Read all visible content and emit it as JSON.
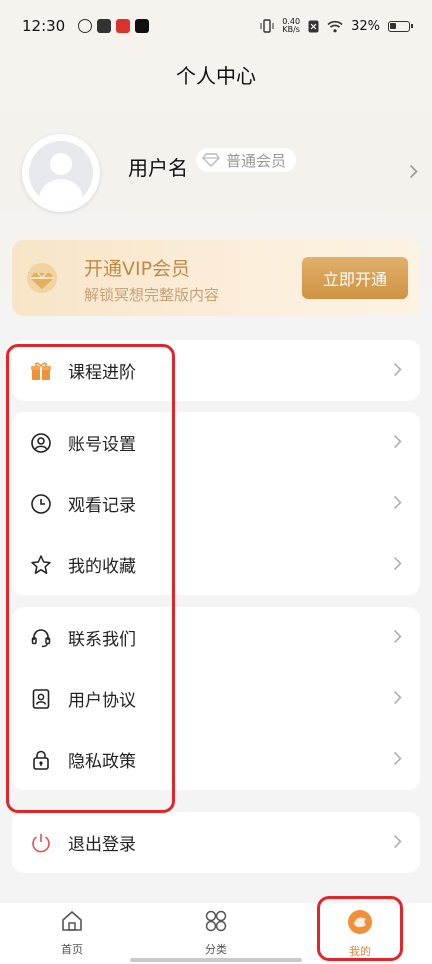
{
  "status_bar": {
    "time": "12:30",
    "network_speed_value": "0.40",
    "network_speed_unit": "KB/s",
    "battery": "32%"
  },
  "header": {
    "title": "个人中心"
  },
  "profile": {
    "username": "用户名",
    "member_level": "普通会员"
  },
  "vip_banner": {
    "title": "开通VIP会员",
    "subtitle": "解锁冥想完整版内容",
    "button_label": "立即开通"
  },
  "menu_groups": [
    [
      {
        "label": "课程进阶",
        "icon": "gift-icon"
      }
    ],
    [
      {
        "label": "账号设置",
        "icon": "user-circle-icon"
      },
      {
        "label": "观看记录",
        "icon": "clock-icon"
      },
      {
        "label": "我的收藏",
        "icon": "star-icon"
      }
    ],
    [
      {
        "label": "联系我们",
        "icon": "headset-icon"
      },
      {
        "label": "用户协议",
        "icon": "contact-card-icon"
      },
      {
        "label": "隐私政策",
        "icon": "lock-icon"
      }
    ],
    [
      {
        "label": "退出登录",
        "icon": "power-icon"
      }
    ]
  ],
  "bottom_nav": [
    {
      "label": "首页",
      "icon": "home-icon"
    },
    {
      "label": "分类",
      "icon": "grid-icon"
    },
    {
      "label": "我的",
      "icon": "profile-icon",
      "active": true
    }
  ],
  "colors": {
    "accent": "#e0893a",
    "vip_gold": "#c08a45",
    "annotation_red": "#e1262a",
    "logout_red": "#d9534f"
  }
}
